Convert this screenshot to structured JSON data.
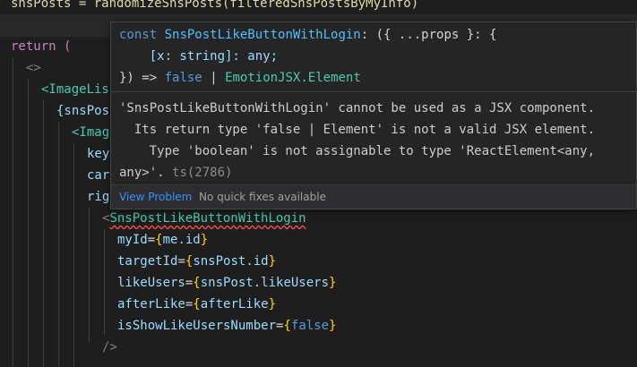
{
  "editor": {
    "line0": "snsPosts = randomizeSnsPosts(filteredSnsPostsByMyInfo)",
    "line_return": "return (",
    "line_fragment": "<>",
    "line_imagelist": "<ImageLis",
    "line_snspost": "{snsPost",
    "line_image": "<Imag",
    "line_key": "key",
    "line_car": "car",
    "line_rig": "rig",
    "component_open": "<",
    "component_name": "SnsPostLikeButtonWithLogin",
    "props": [
      {
        "name": "myId",
        "value": "me.id"
      },
      {
        "name": "targetId",
        "value": "snsPost.id"
      },
      {
        "name": "likeUsers",
        "value": "snsPost.likeUsers"
      },
      {
        "name": "afterLike",
        "value": "afterLike"
      },
      {
        "name": "isShowLikeUsersNumber",
        "value": "false"
      }
    ],
    "self_close": "/>"
  },
  "hover": {
    "sig_line1_const": "const",
    "sig_line1_name": "SnsPostLikeButtonWithLogin",
    "sig_line1_rest": ": ({ ...props }: {",
    "sig_line2": "[x: string]: any;",
    "sig_line3_start": "}) =>",
    "sig_line3_false": "false",
    "sig_line3_pipe": "|",
    "sig_line3_type": "EmotionJSX.Element",
    "message_line1": "'SnsPostLikeButtonWithLogin' cannot be used as a JSX component.",
    "message_line2": "  Its return type 'false | Element' is not a valid JSX element.",
    "message_line3": "    Type 'boolean' is not assignable to type 'ReactElement<any,",
    "message_line4": "any>'.",
    "error_code": "ts(2786)",
    "view_problem": "View Problem",
    "no_fixes": "No quick fixes available"
  }
}
